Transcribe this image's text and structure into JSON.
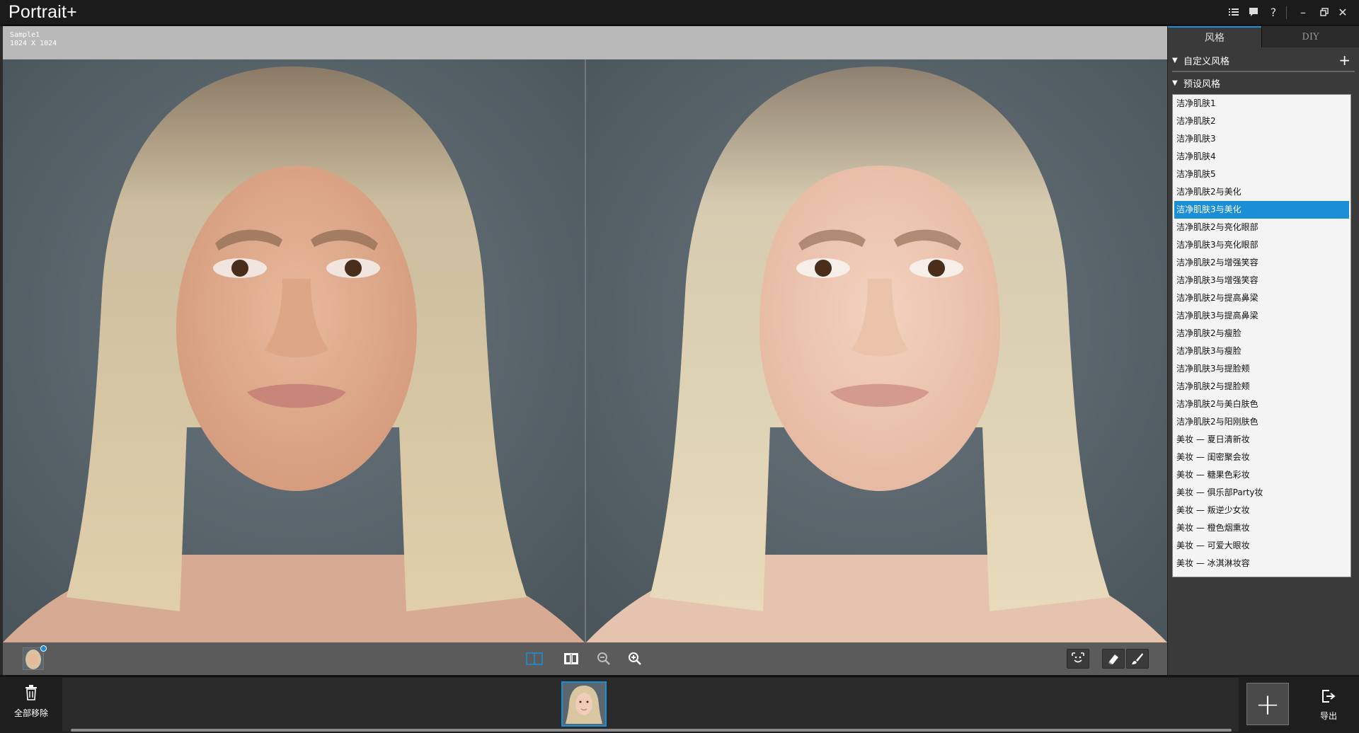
{
  "app": {
    "title": "Portrait+"
  },
  "titlebar": {
    "icons": [
      "menu-list-icon",
      "chat-icon",
      "help-icon",
      "minimize-icon",
      "restore-icon",
      "close-icon"
    ],
    "help_glyph": "?",
    "minimize_glyph": "–",
    "close_glyph": "✕"
  },
  "image": {
    "name": "Sample1",
    "size": "1024 X 1024"
  },
  "view_toolbar": {
    "buttons": [
      "split-view-icon",
      "compare-view-icon",
      "zoom-out-icon",
      "zoom-in-icon",
      "face-detect-icon",
      "eraser-icon",
      "brush-icon"
    ]
  },
  "right_panel": {
    "tabs": [
      {
        "label": "风格",
        "active": true
      },
      {
        "label": "DIY",
        "active": false
      }
    ],
    "custom_section": {
      "label": "自定义风格",
      "add_glyph": "+"
    },
    "preset_section": {
      "label": "预设风格"
    },
    "presets": [
      "洁净肌肤1",
      "洁净肌肤2",
      "洁净肌肤3",
      "洁净肌肤4",
      "洁净肌肤5",
      "洁净肌肤2与美化",
      "洁净肌肤3与美化",
      "洁净肌肤2与亮化眼部",
      "洁净肌肤3与亮化眼部",
      "洁净肌肤2与增强笑容",
      "洁净肌肤3与增强笑容",
      "洁净肌肤2与提高鼻梁",
      "洁净肌肤3与提高鼻梁",
      "洁净肌肤2与瘦脸",
      "洁净肌肤3与瘦脸",
      "洁净肌肤3与提脸颊",
      "洁净肌肤2与提脸颊",
      "洁净肌肤2与美白肤色",
      "洁净肌肤2与阳刚肤色",
      "美妆 — 夏日清新妆",
      "美妆 — 闺密聚会妆",
      "美妆 — 糖果色彩妆",
      "美妆 — 俱乐部Party妆",
      "美妆 — 叛逆少女妆",
      "美妆 — 橙色烟熏妆",
      "美妆 — 可爱大眼妆",
      "美妆 — 冰淇淋妆容"
    ],
    "selected_index": 6,
    "accent_color": "#1a8fd6"
  },
  "bottom": {
    "remove_all_label": "全部移除",
    "export_label": "导出",
    "add_glyph": "+"
  }
}
